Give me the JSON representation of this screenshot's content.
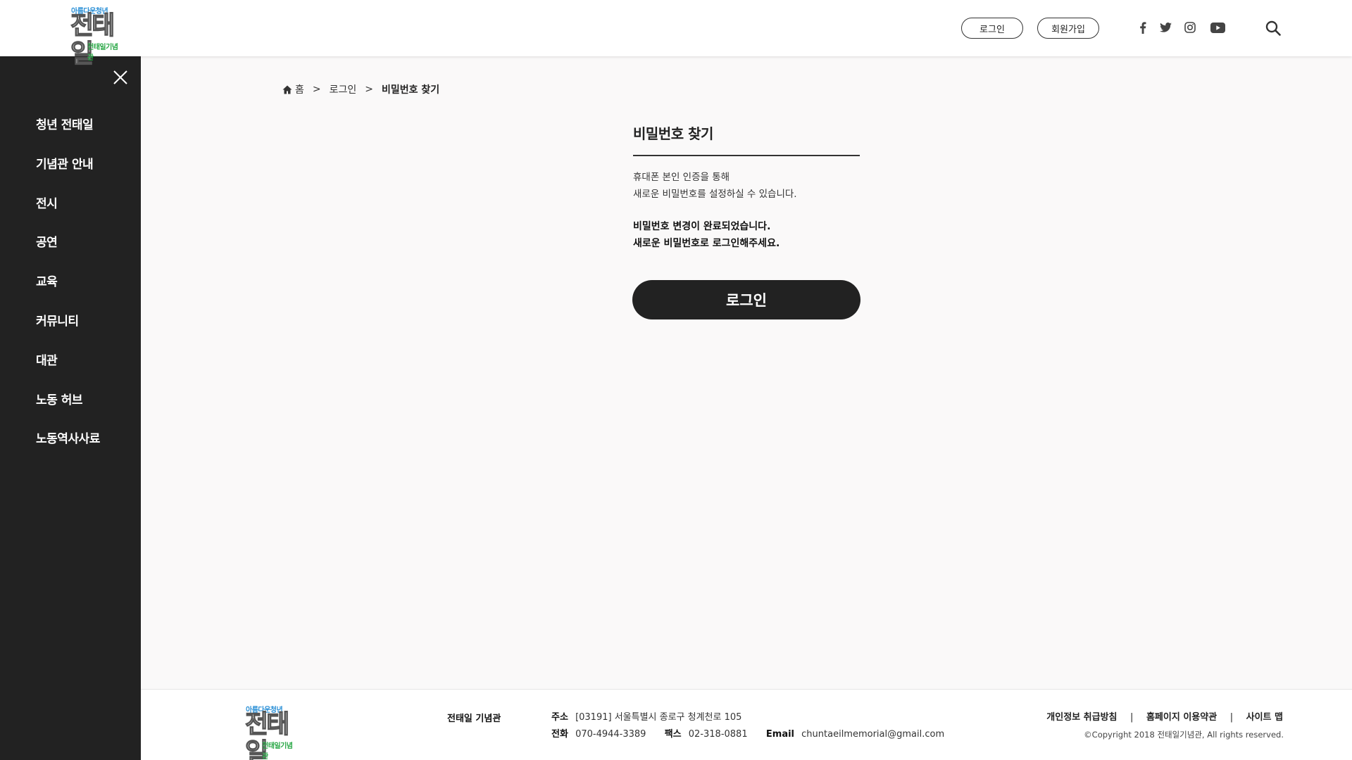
{
  "header": {
    "logo": {
      "top": "아름다운청년",
      "main": "전태일",
      "bottom": "전태일기념관"
    },
    "login_label": "로그인",
    "signup_label": "회원가입",
    "social": [
      "facebook-icon",
      "twitter-icon",
      "instagram-icon",
      "youtube-icon"
    ],
    "search_icon": "search-icon"
  },
  "sidebar": {
    "items": [
      {
        "label": "청년 전태일"
      },
      {
        "label": "기념관 안내"
      },
      {
        "label": "전시"
      },
      {
        "label": "공연"
      },
      {
        "label": "교육"
      },
      {
        "label": "커뮤니티"
      },
      {
        "label": "대관"
      },
      {
        "label": "노동 허브"
      },
      {
        "label": "노동역사사료"
      }
    ]
  },
  "breadcrumb": {
    "home": "홈",
    "sep": ">",
    "level1": "로그인",
    "current": "비밀번호 찾기"
  },
  "main": {
    "title": "비밀번호 찾기",
    "desc_line1": "휴대폰 본인 인증을 통해",
    "desc_line2": "새로운 비밀번호를 설정하실 수 있습니다.",
    "done_line1": "비밀번호 변경이 완료되었습니다.",
    "done_line2": "새로운 비밀번호로 로그인해주세요.",
    "login_button": "로그인"
  },
  "footer": {
    "logo": {
      "top": "아름다운청년",
      "main": "전태일",
      "bottom": "전태일기념관"
    },
    "name": "전태일 기념관",
    "address_label": "주소",
    "address": "[03191] 서울특별시 종로구 청계천로 105",
    "phone_label": "전화",
    "phone": "070-4944-3389",
    "fax_label": "팩스",
    "fax": "02-318-0881",
    "email_label": "Email",
    "email": "chuntaeilmemorial@gmail.com",
    "links": [
      "개인정보 취급방침",
      "홈페이지 이용약관",
      "사이트 맵"
    ],
    "link_sep": "|",
    "copyright": "©Copyright 2018 전태일기념관, All rights reserved."
  },
  "colors": {
    "dark": "#222222",
    "logo_blue": "#2a8fd6",
    "logo_green": "#28a745",
    "bg": "#faf9f9"
  }
}
